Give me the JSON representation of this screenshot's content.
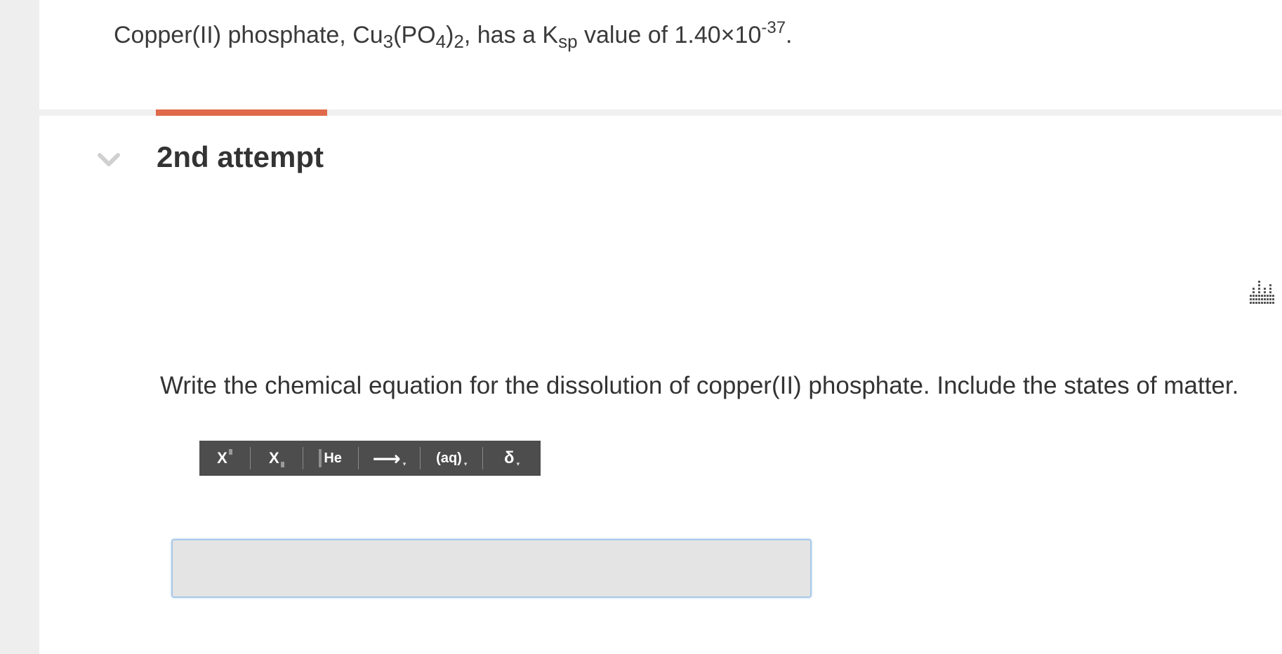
{
  "question": {
    "part1": "Copper(II) phosphate, Cu",
    "sub1": "3",
    "part2": "(PO",
    "sub2": "4",
    "part3": ")",
    "sub3": "2",
    "part4": ", has a K",
    "sub4": "sp",
    "part5": " value of 1.40×10",
    "sup1": "-37",
    "part6": "."
  },
  "attempt": {
    "title": "2nd attempt"
  },
  "prompt": "Write the chemical equation for the dissolution of copper(II) phosphate. Include the states of matter.",
  "toolbar": {
    "superscript_label": "X",
    "subscript_label": "X",
    "element_label": "He",
    "arrow_label": "⟶",
    "state_label": "(aq)",
    "delta_label": "δ",
    "caret": "▾"
  },
  "colors": {
    "accent": "#e0694a",
    "toolbar_bg": "#4d4d4d",
    "answer_border": "#a8c8e8"
  },
  "icons": [
    "chevron-down-icon",
    "resource-grid-icon"
  ]
}
